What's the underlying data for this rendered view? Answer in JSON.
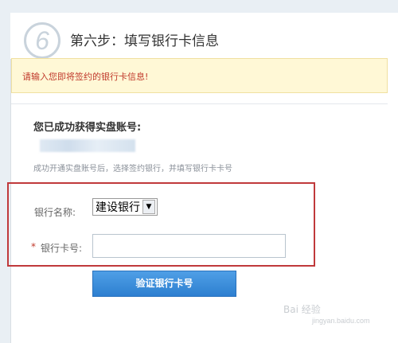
{
  "step": {
    "number_glyph": "6",
    "title": "第六步：填写银行卡信息"
  },
  "notice": {
    "text": "请输入您即将签约的银行卡信息!"
  },
  "account": {
    "title": "您已成功获得实盘账号:",
    "hint": "成功开通实盘账号后，选择签约银行，并填写银行卡卡号"
  },
  "form": {
    "bank_label": "银行名称:",
    "bank_selected": "建设银行",
    "required_mark": "*",
    "card_label": "银行卡号:",
    "card_value": ""
  },
  "actions": {
    "verify_label": "验证银行卡号"
  },
  "watermark": {
    "text": "Bai 经验",
    "sub": "jingyan.baidu.com"
  },
  "colors": {
    "accent": "#2d7fd0",
    "highlight_frame": "#c0393b",
    "notice_bg": "#fff8d6"
  }
}
